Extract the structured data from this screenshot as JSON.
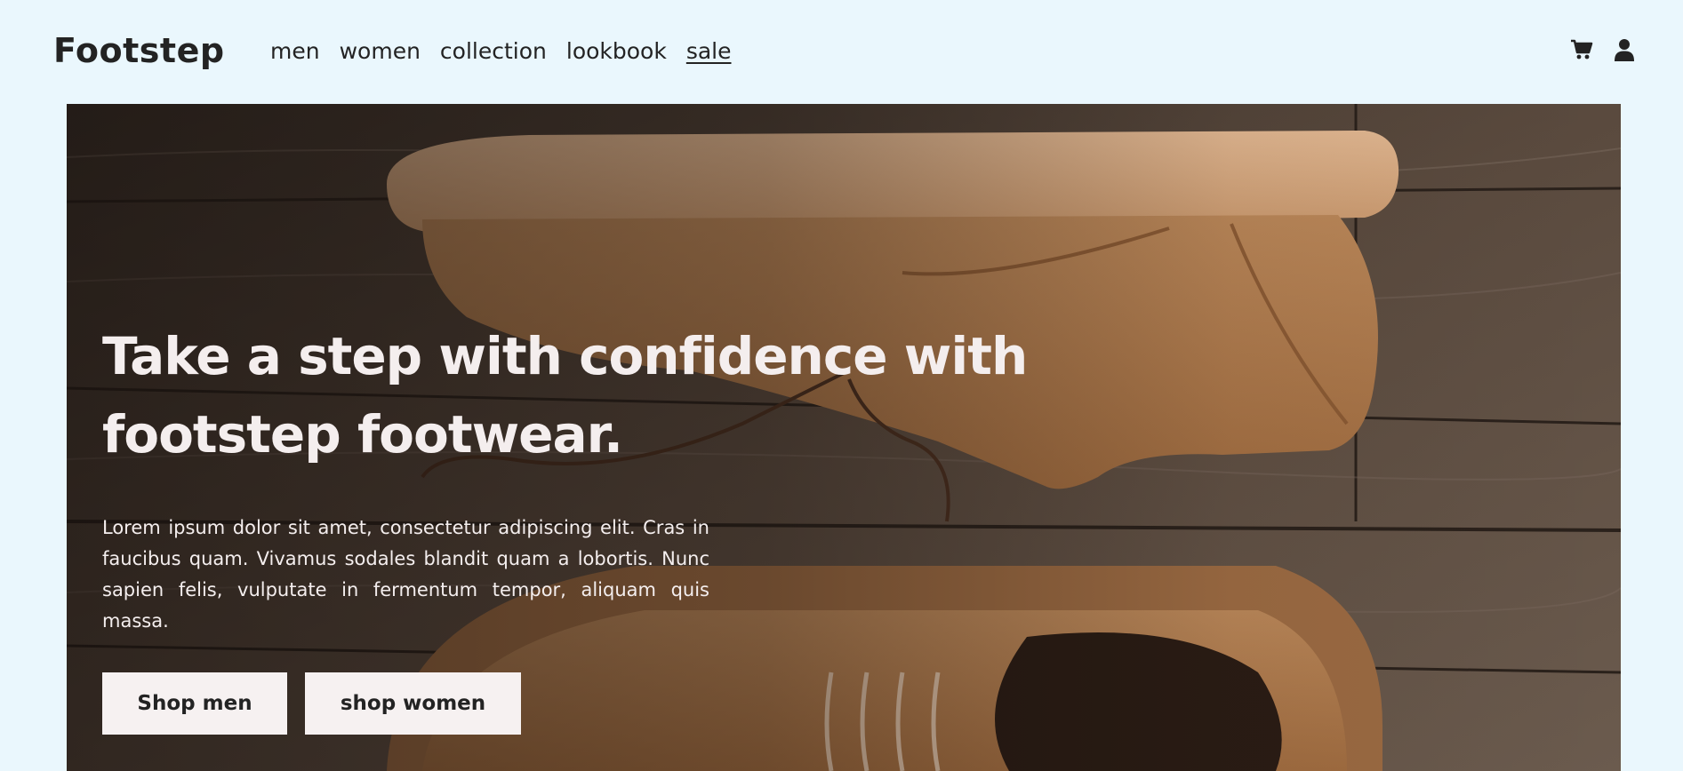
{
  "header": {
    "brand": "Footstep",
    "nav": [
      {
        "label": "men"
      },
      {
        "label": "women"
      },
      {
        "label": "collection"
      },
      {
        "label": "lookbook"
      },
      {
        "label": "sale"
      }
    ],
    "icons": [
      "cart-icon",
      "user-icon"
    ]
  },
  "hero": {
    "title": "Take a step with confidence with footstep footwear.",
    "body": "Lorem ipsum dolor sit amet, consectetur adipiscing elit. Cras in faucibus quam. Vivamus sodales blandit quam a lobortis. Nunc sapien felis, vulputate in fermentum tempor, aliquam quis massa.",
    "buttons": {
      "men": "Shop men",
      "women": "shop women"
    }
  },
  "colors": {
    "page_bg": "#eaf7fd",
    "text_dark": "#232323",
    "hero_text": "#f4eeee",
    "button_bg": "#f6f1f1"
  }
}
